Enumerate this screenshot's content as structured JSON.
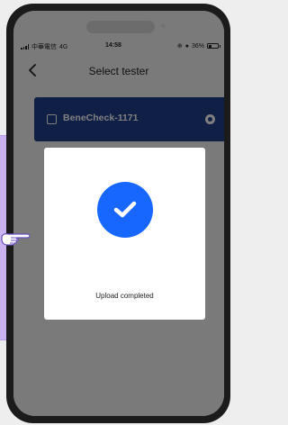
{
  "status_bar": {
    "carrier": "中華電信",
    "network": "4G",
    "time": "14:58",
    "battery": "36%",
    "battery_level": 0.36
  },
  "nav": {
    "back_icon": "chevron-left-icon",
    "title": "Select tester"
  },
  "device_list": [
    {
      "name": "BeneCheck-1171",
      "checked": false,
      "selected": true
    }
  ],
  "dialog": {
    "icon": "check-circle-icon",
    "message": "Upload completed"
  },
  "colors": {
    "device_card": "#203e8a",
    "success_icon": "#1767ff",
    "side_panel": "#c9b3ee"
  }
}
